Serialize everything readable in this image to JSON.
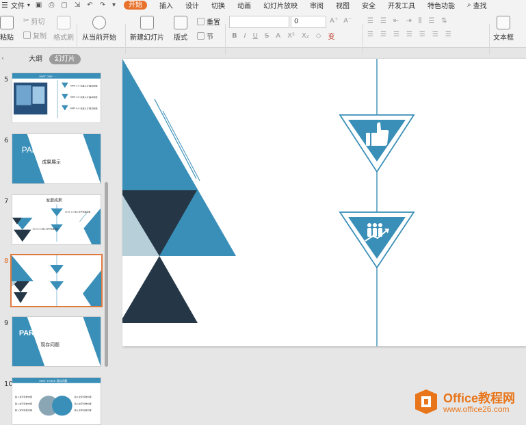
{
  "menubar": {
    "file_label": "文件",
    "tabs": [
      "开始",
      "插入",
      "设计",
      "切换",
      "动画",
      "幻灯片放映",
      "审阅",
      "视图",
      "安全",
      "开发工具",
      "特色功能"
    ],
    "search_label": "查找"
  },
  "ribbon": {
    "paste_label": "粘贴",
    "cut_label": "剪切",
    "copy_label": "复制",
    "format_painter_label": "格式刷",
    "play_from_current_label": "从当前开始",
    "new_slide_label": "新建幻灯片",
    "layout_label": "版式",
    "reset_label": "重置",
    "section_label": "节",
    "font_name_value": "",
    "font_size_value": "0",
    "textbox_label": "文本框"
  },
  "panel": {
    "outline_tab": "大纲",
    "slides_tab": "幻灯片"
  },
  "slides": [
    {
      "num": "5",
      "header": "PART  ONE  · · ·",
      "bullets": [
        "PART 2.0 标准人才基本技能",
        "PART 3.0 标准人才基本技能",
        "PART 4.0 标准人才基本技能"
      ]
    },
    {
      "num": "6",
      "title": "PART  TWO",
      "subtitle": "成果展示"
    },
    {
      "num": "7",
      "title": "发展成果",
      "label_a": "2016.1.0 输入文字标准内容",
      "label_b": "2016.2.0 输入文字标准内容"
    },
    {
      "num": "8"
    },
    {
      "num": "9",
      "title": "PART  THREE",
      "subtitle": "现存问题"
    },
    {
      "num": "10",
      "header": "PART  THREE  现存问题",
      "left_items": [
        "输入文字标准内容",
        "输入文字标准内容",
        "输入文字标准内容"
      ],
      "right_items": [
        "输入文字标准内容",
        "输入文字标准内容",
        "输入文字标准内容"
      ]
    }
  ],
  "watermark": {
    "brand": "Office教程网",
    "url": "www.office26.com"
  },
  "colors": {
    "accent_blue": "#3a8fb8",
    "dark_navy": "#253746",
    "light_blue_gray": "#b7cfd8",
    "active_tab_orange": "#e8722c",
    "selection_orange": "#e07a3c"
  },
  "icons": {
    "upper_triangle_icon": "thumbs-up-icon",
    "lower_triangle_icon": "team-growth-icon"
  }
}
